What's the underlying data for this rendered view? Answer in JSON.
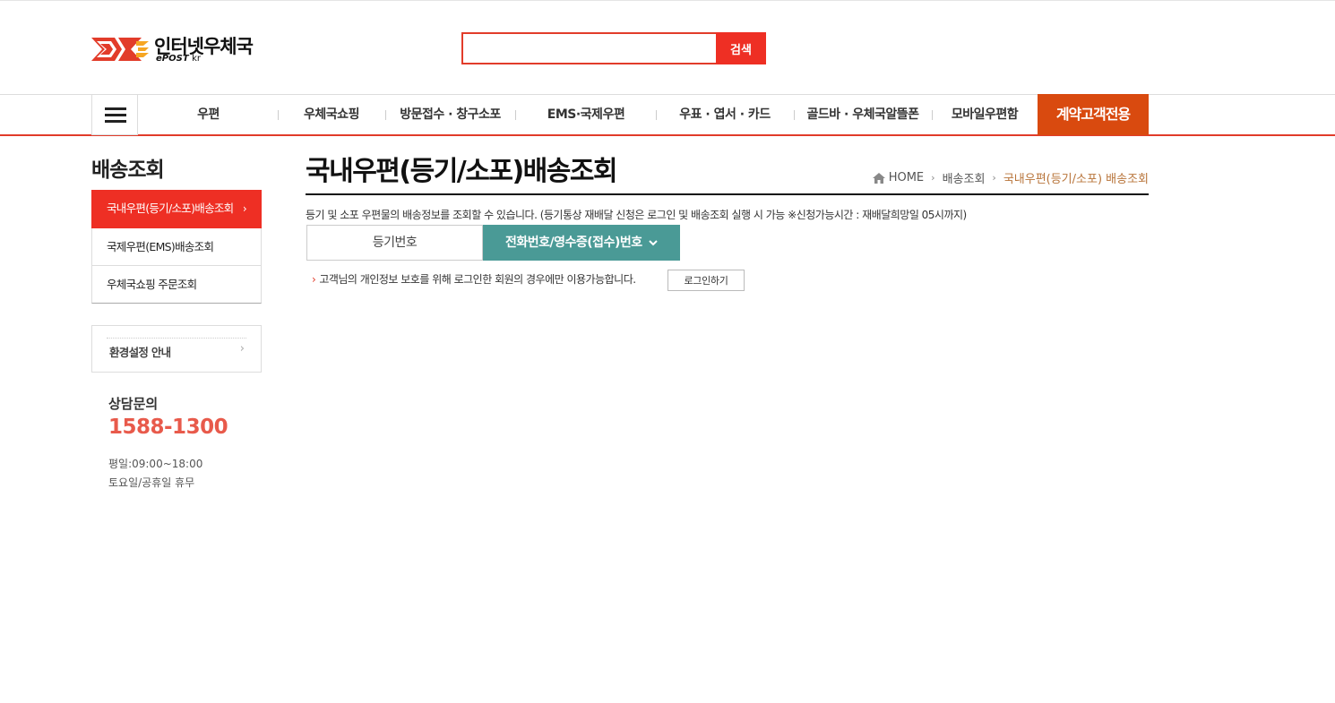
{
  "header": {
    "logo_title": "인터넷우체국",
    "logo_sub_brand": "ePOST",
    "logo_sub_domain": "kr",
    "search_placeholder": "",
    "search_button": "검색"
  },
  "nav": {
    "items": [
      {
        "label": "우편"
      },
      {
        "label": "우체국쇼핑"
      },
      {
        "label": "방문접수 · 창구소포"
      },
      {
        "label": "EMS·국제우편"
      },
      {
        "label": "우표 · 엽서 · 카드"
      },
      {
        "label": "골드바 · 우체국알뜰폰"
      },
      {
        "label": "모바일우편함"
      }
    ],
    "contract_label": "계약고객전용"
  },
  "sidebar": {
    "title": "배송조회",
    "items": [
      {
        "label": "국내우편(등기/소포)배송조회",
        "active": true
      },
      {
        "label": "국제우편(EMS)배송조회"
      },
      {
        "label": "우체국쇼핑 주문조회"
      }
    ],
    "active_arrow": "›",
    "env_label": "환경설정 안내",
    "env_arrow": "›",
    "counsel_title": "상담문의",
    "counsel_phone": "1588-1300",
    "hours_weekday": "평일:09:00~18:00",
    "hours_weekend": "토요일/공휴일 휴무"
  },
  "main": {
    "title": "국내우편(등기/소포)배송조회",
    "breadcrumb": {
      "home": "HOME",
      "sep": "›",
      "level1": "배송조회",
      "current": "국내우편(등기/소포) 배송조회"
    },
    "description": "등기 및 소포 우편물의 배송정보를 조회할 수 있습니다. (등기통상 재배달 신청은 로그인 및 배송조회 실행 시 가능 ※신청가능시간 : 재배달희망일 05시까지)",
    "tabs": {
      "registered": "등기번호",
      "phone": "전화번호/영수증(접수)번호"
    },
    "notice_mark": "›",
    "notice": "고객님의 개인정보 보호를 위해 로그인한 회원의 경우에만 이용가능합니다.",
    "login_button": "로그인하기"
  },
  "colors": {
    "brand_red": "#ee2f24",
    "contract_orange": "#d94a0f",
    "tab_teal": "#4a9a96",
    "phone_red": "#e85a4b",
    "breadcrumb_current": "#b8743a"
  }
}
